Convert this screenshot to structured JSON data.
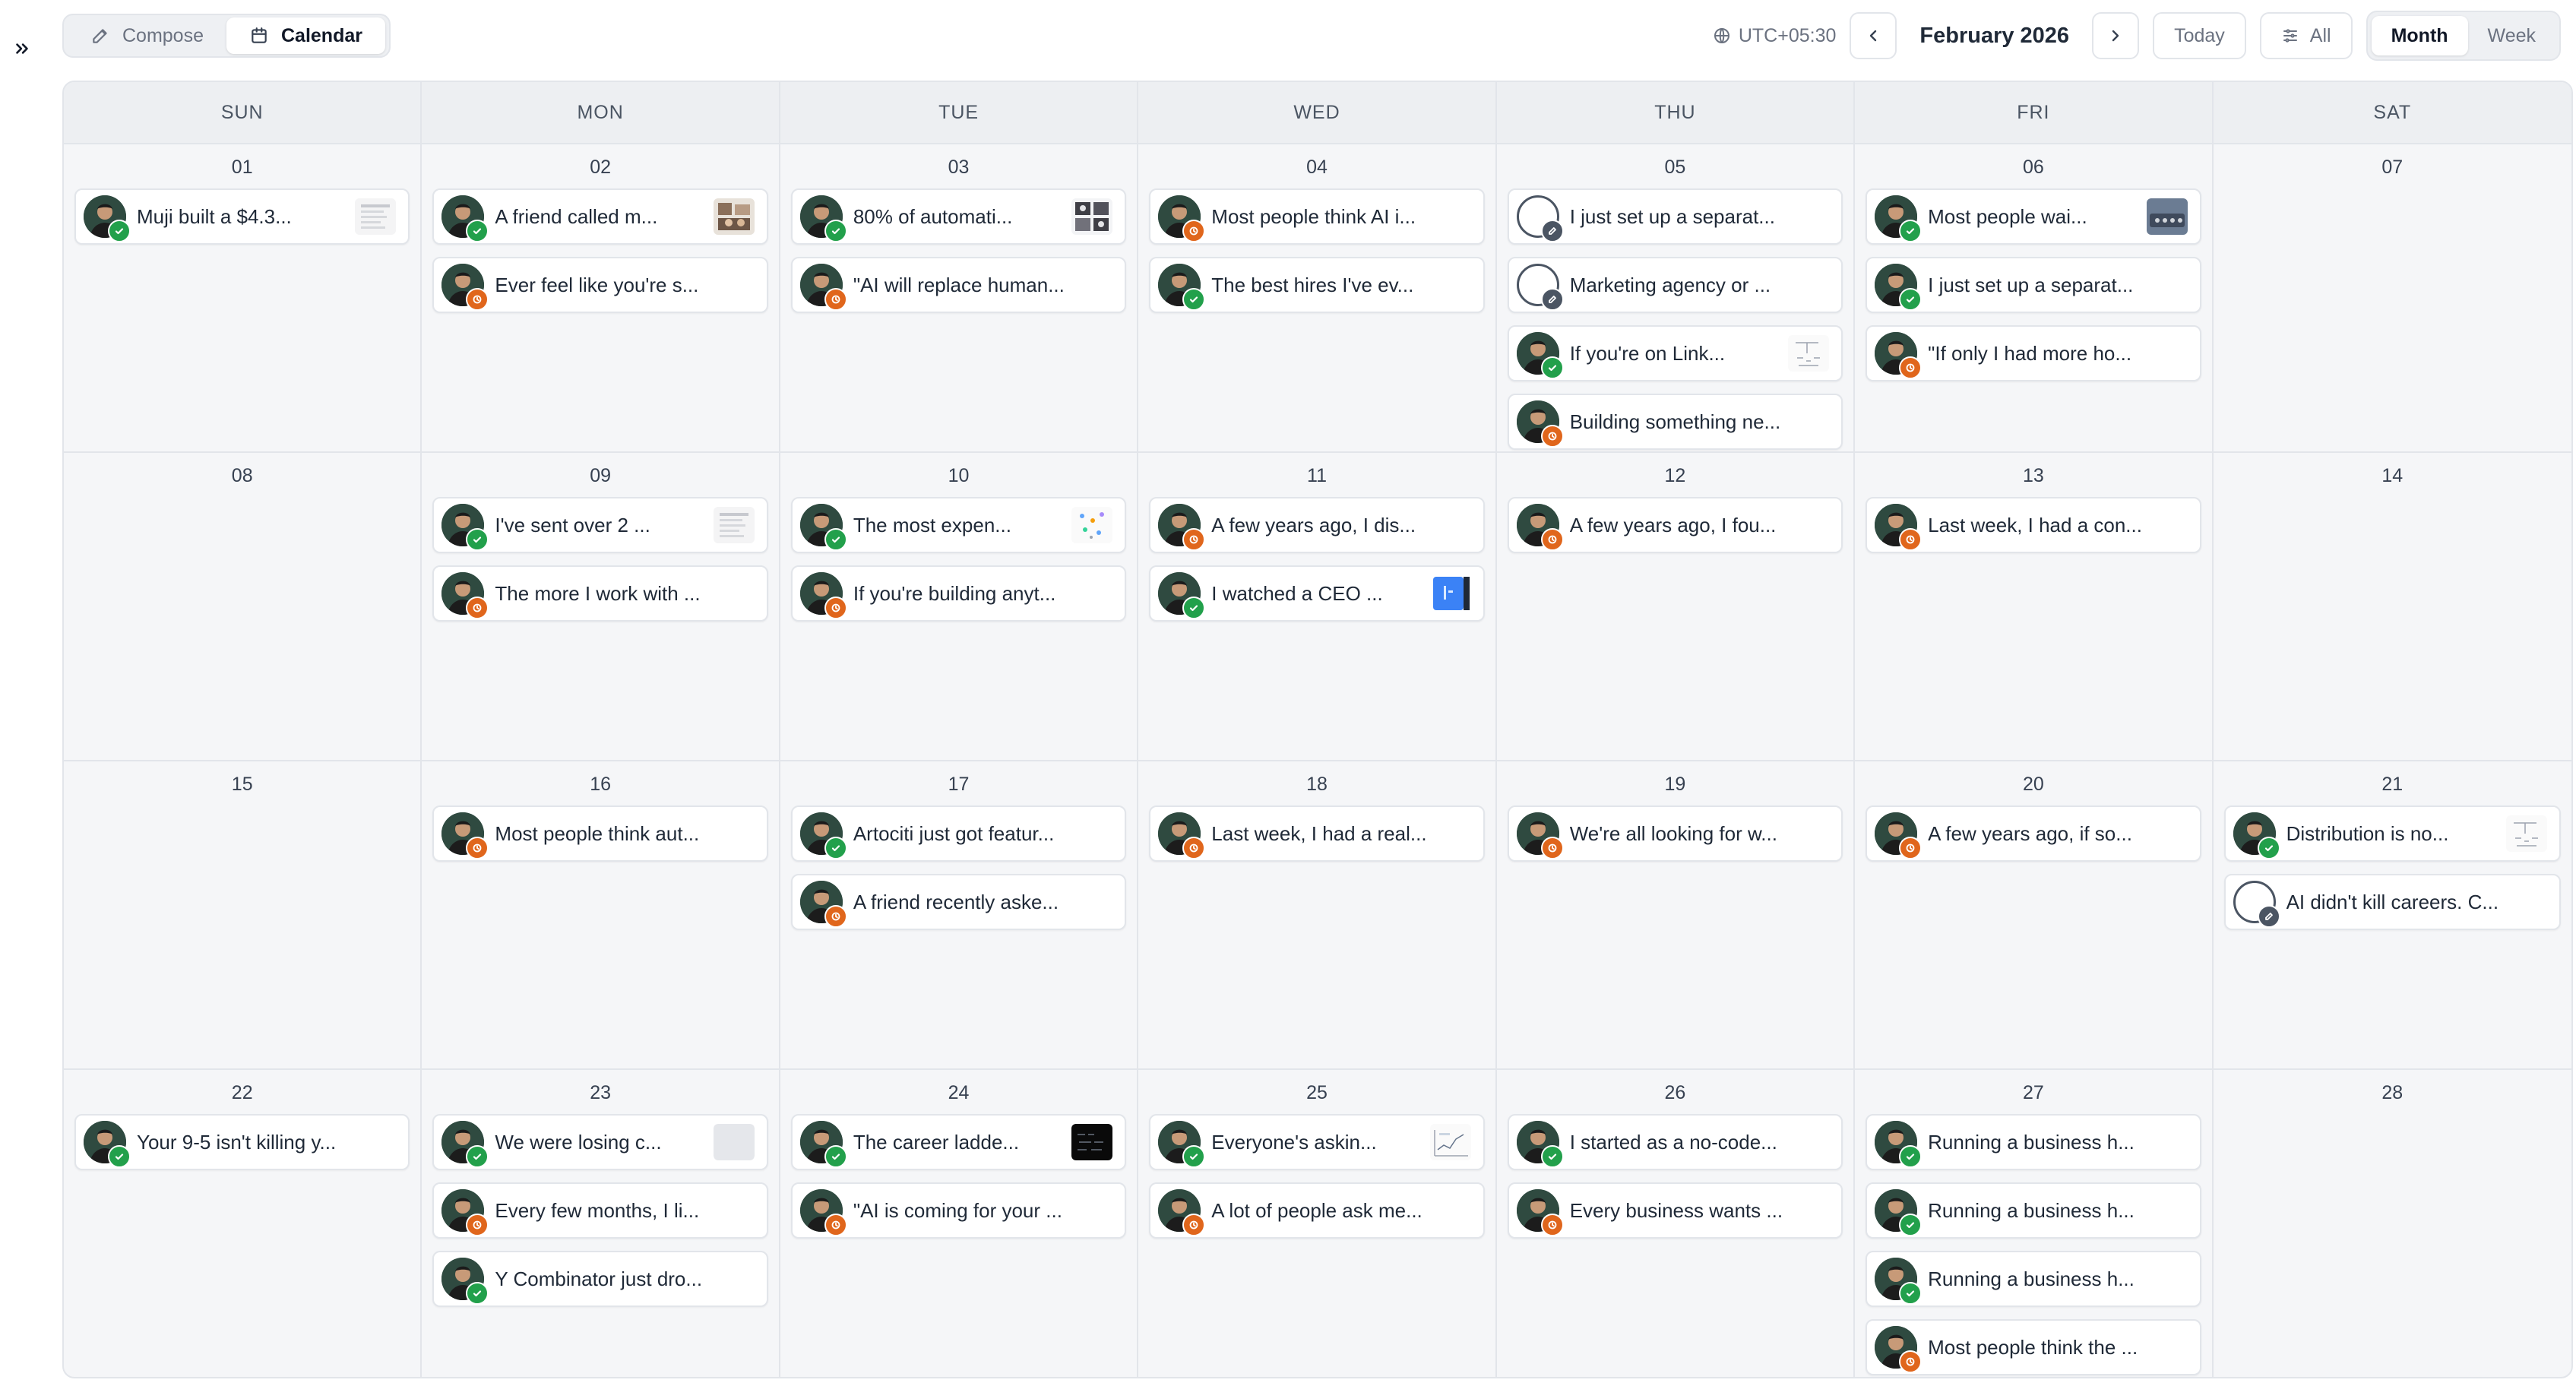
{
  "toolbar": {
    "compose_label": "Compose",
    "calendar_label": "Calendar",
    "timezone": "UTC+05:30",
    "month_label": "February 2026",
    "today_label": "Today",
    "filter_label": "All",
    "view_month": "Month",
    "view_week": "Week"
  },
  "colors": {
    "posted": "#22a04b",
    "scheduled": "#e0661c",
    "draft": "#4b5563"
  },
  "weekdays": [
    "SUN",
    "MON",
    "TUE",
    "WED",
    "THU",
    "FRI",
    "SAT"
  ],
  "days": [
    {
      "date": "01",
      "posts": [
        {
          "text": "Muji built a $4.3...",
          "status": "posted",
          "thumb": "doc"
        }
      ]
    },
    {
      "date": "02",
      "posts": [
        {
          "text": "A friend called m...",
          "status": "posted",
          "thumb": "photo"
        },
        {
          "text": "Ever feel like you're s...",
          "status": "scheduled"
        }
      ]
    },
    {
      "date": "03",
      "posts": [
        {
          "text": "80% of automati...",
          "status": "posted",
          "thumb": "grid"
        },
        {
          "text": "\"AI will replace human...",
          "status": "scheduled"
        }
      ]
    },
    {
      "date": "04",
      "posts": [
        {
          "text": "Most people think AI i...",
          "status": "scheduled"
        },
        {
          "text": "The best hires I've ev...",
          "status": "posted"
        }
      ]
    },
    {
      "date": "05",
      "posts": [
        {
          "text": "I just set up a separat...",
          "status": "draft"
        },
        {
          "text": "Marketing agency or ...",
          "status": "draft"
        },
        {
          "text": "If you're on Link...",
          "status": "posted",
          "thumb": "sketch"
        },
        {
          "text": "Building something ne...",
          "status": "scheduled"
        }
      ]
    },
    {
      "date": "06",
      "posts": [
        {
          "text": "Most people wai...",
          "status": "posted",
          "thumb": "dark"
        },
        {
          "text": "I just set up a separat...",
          "status": "posted"
        },
        {
          "text": "\"If only I had more ho...",
          "status": "scheduled"
        }
      ]
    },
    {
      "date": "07",
      "posts": []
    },
    {
      "date": "08",
      "posts": []
    },
    {
      "date": "09",
      "posts": [
        {
          "text": "I've sent over 2 ...",
          "status": "posted",
          "thumb": "doc"
        },
        {
          "text": "The more I work with ...",
          "status": "scheduled"
        }
      ]
    },
    {
      "date": "10",
      "posts": [
        {
          "text": "The most expen...",
          "status": "posted",
          "thumb": "dots"
        },
        {
          "text": "If you're building anyt...",
          "status": "scheduled"
        }
      ]
    },
    {
      "date": "11",
      "posts": [
        {
          "text": "A few years ago, I dis...",
          "status": "scheduled"
        },
        {
          "text": "I watched a CEO ...",
          "status": "posted",
          "thumb": "blue"
        }
      ]
    },
    {
      "date": "12",
      "posts": [
        {
          "text": "A few years ago, I fou...",
          "status": "scheduled"
        }
      ]
    },
    {
      "date": "13",
      "posts": [
        {
          "text": "Last week, I had a con...",
          "status": "scheduled"
        }
      ]
    },
    {
      "date": "14",
      "posts": []
    },
    {
      "date": "15",
      "posts": []
    },
    {
      "date": "16",
      "posts": [
        {
          "text": "Most people think aut...",
          "status": "scheduled"
        }
      ]
    },
    {
      "date": "17",
      "posts": [
        {
          "text": "Artociti just got featur...",
          "status": "posted"
        },
        {
          "text": "A friend recently aske...",
          "status": "scheduled"
        }
      ]
    },
    {
      "date": "18",
      "posts": [
        {
          "text": "Last week, I had a real...",
          "status": "scheduled"
        }
      ]
    },
    {
      "date": "19",
      "posts": [
        {
          "text": "We're all looking for w...",
          "status": "scheduled"
        }
      ]
    },
    {
      "date": "20",
      "posts": [
        {
          "text": "A few years ago, if so...",
          "status": "scheduled"
        }
      ]
    },
    {
      "date": "21",
      "posts": [
        {
          "text": "Distribution is no...",
          "status": "posted",
          "thumb": "sketch"
        },
        {
          "text": "AI didn't kill careers. C...",
          "status": "draft"
        }
      ]
    },
    {
      "date": "22",
      "posts": [
        {
          "text": "Your 9-5 isn't killing y...",
          "status": "posted"
        }
      ]
    },
    {
      "date": "23",
      "posts": [
        {
          "text": "We were losing c...",
          "status": "posted",
          "thumb": "blank"
        },
        {
          "text": "Every few months, I li...",
          "status": "scheduled"
        },
        {
          "text": "Y Combinator just dro...",
          "status": "posted"
        }
      ]
    },
    {
      "date": "24",
      "posts": [
        {
          "text": "The career ladde...",
          "status": "posted",
          "thumb": "black"
        },
        {
          "text": "\"AI is coming for your ...",
          "status": "scheduled"
        }
      ]
    },
    {
      "date": "25",
      "posts": [
        {
          "text": "Everyone's askin...",
          "status": "posted",
          "thumb": "chart"
        },
        {
          "text": "A lot of people ask me...",
          "status": "scheduled"
        }
      ]
    },
    {
      "date": "26",
      "posts": [
        {
          "text": "I started as a no-code...",
          "status": "posted"
        },
        {
          "text": "Every business wants ...",
          "status": "scheduled"
        }
      ]
    },
    {
      "date": "27",
      "posts": [
        {
          "text": "Running a business h...",
          "status": "posted"
        },
        {
          "text": "Running a business h...",
          "status": "posted"
        },
        {
          "text": "Running a business h...",
          "status": "posted"
        },
        {
          "text": "Most people think the ...",
          "status": "scheduled"
        }
      ]
    },
    {
      "date": "28",
      "posts": []
    }
  ]
}
